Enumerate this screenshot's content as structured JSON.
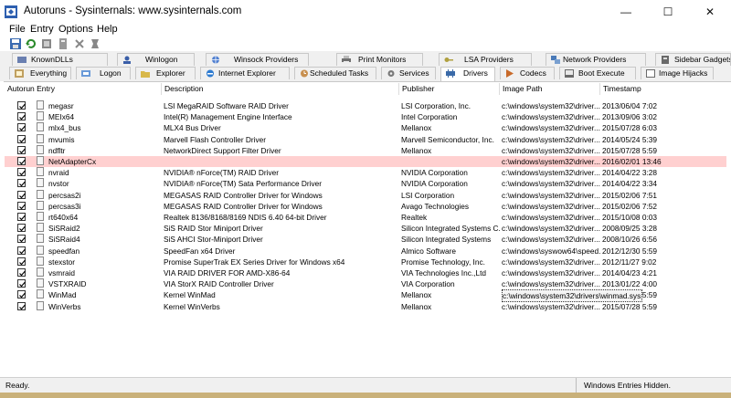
{
  "window": {
    "title": "Autoruns - Sysinternals: www.sysinternals.com",
    "minimize": "—",
    "maximize": "☐",
    "close": "✕"
  },
  "menu": [
    "File",
    "Entry",
    "Options",
    "Help"
  ],
  "toolbar": [
    "save-icon",
    "refresh-icon",
    "filter-icon",
    "jump-icon",
    "delete-icon",
    "find-icon"
  ],
  "tabs_row1": [
    {
      "label": "KnownDLLs",
      "icon": "dll-icon",
      "color": "#6a7fb0"
    },
    {
      "label": "Winlogon",
      "icon": "user-icon",
      "color": "#3a5ea8"
    },
    {
      "label": "Winsock Providers",
      "icon": "globe-icon",
      "color": "#4f7fd0"
    },
    {
      "label": "Print Monitors",
      "icon": "printer-icon",
      "color": "#707070"
    },
    {
      "label": "LSA Providers",
      "icon": "key-icon",
      "color": "#b0a040"
    },
    {
      "label": "Network Providers",
      "icon": "network-icon",
      "color": "#4a7ab8"
    },
    {
      "label": "Sidebar Gadgets",
      "icon": "gadget-icon",
      "color": "#6a6a6a"
    }
  ],
  "tabs_row2": [
    {
      "label": "Everything",
      "icon": "everything-icon",
      "color": "#c0a060"
    },
    {
      "label": "Logon",
      "icon": "logon-icon",
      "color": "#6a9ad8"
    },
    {
      "label": "Explorer",
      "icon": "folder-icon",
      "color": "#d8b84a"
    },
    {
      "label": "Internet Explorer",
      "icon": "ie-icon",
      "color": "#2e7bd0"
    },
    {
      "label": "Scheduled Tasks",
      "icon": "clock-icon",
      "color": "#c89050"
    },
    {
      "label": "Services",
      "icon": "gear-icon",
      "color": "#7a7a7a"
    },
    {
      "label": "Drivers",
      "icon": "driver-icon",
      "color": "#3a6aa8"
    },
    {
      "label": "Codecs",
      "icon": "codec-icon",
      "color": "#c86a2a"
    },
    {
      "label": "Boot Execute",
      "icon": "boot-icon",
      "color": "#6a6a6a"
    },
    {
      "label": "Image Hijacks",
      "icon": "image-icon",
      "color": "#6a6a6a"
    }
  ],
  "active_tab": "Drivers",
  "columns": [
    "Autorun Entry",
    "Description",
    "Publisher",
    "Image Path",
    "Timestamp"
  ],
  "rows": [
    {
      "entry": "megasr",
      "desc": "LSI MegaRAID Software RAID Driver",
      "pub": "LSI Corporation, Inc.",
      "path": "c:\\windows\\system32\\driver...",
      "time": "2013/06/04 7:02"
    },
    {
      "entry": "MEIx64",
      "desc": "Intel(R) Management Engine Interface",
      "pub": "Intel Corporation",
      "path": "c:\\windows\\system32\\driver...",
      "time": "2013/09/06 3:02"
    },
    {
      "entry": "mlx4_bus",
      "desc": "MLX4 Bus Driver",
      "pub": "Mellanox",
      "path": "c:\\windows\\system32\\driver...",
      "time": "2015/07/28 6:03"
    },
    {
      "entry": "mvumis",
      "desc": "Marvell Flash Controller Driver",
      "pub": "Marvell Semiconductor, Inc.",
      "path": "c:\\windows\\system32\\driver...",
      "time": "2014/05/24 5:39"
    },
    {
      "entry": "ndfltr",
      "desc": "NetworkDirect Support Filter Driver",
      "pub": "Mellanox",
      "path": "c:\\windows\\system32\\driver...",
      "time": "2015/07/28 5:59"
    },
    {
      "entry": "NetAdapterCx",
      "desc": "",
      "pub": "",
      "path": "c:\\windows\\system32\\driver...",
      "time": "2016/02/01 13:46",
      "highlight": true
    },
    {
      "entry": "nvraid",
      "desc": "NVIDIA® nForce(TM) RAID Driver",
      "pub": "NVIDIA Corporation",
      "path": "c:\\windows\\system32\\driver...",
      "time": "2014/04/22 3:28"
    },
    {
      "entry": "nvstor",
      "desc": "NVIDIA® nForce(TM) Sata Performance Driver",
      "pub": "NVIDIA Corporation",
      "path": "c:\\windows\\system32\\driver...",
      "time": "2014/04/22 3:34"
    },
    {
      "entry": "percsas2i",
      "desc": "MEGASAS RAID Controller Driver for Windows",
      "pub": "LSI Corporation",
      "path": "c:\\windows\\system32\\driver...",
      "time": "2015/02/06 7:51"
    },
    {
      "entry": "percsas3i",
      "desc": "MEGASAS RAID Controller Driver for Windows",
      "pub": "Avago Technologies",
      "path": "c:\\windows\\system32\\driver...",
      "time": "2015/02/06 7:52"
    },
    {
      "entry": "rt640x64",
      "desc": "Realtek 8136/8168/8169 NDIS 6.40 64-bit Driver",
      "pub": "Realtek",
      "path": "c:\\windows\\system32\\driver...",
      "time": "2015/10/08 0:03"
    },
    {
      "entry": "SiSRaid2",
      "desc": "SiS RAID Stor Miniport Driver",
      "pub": "Silicon Integrated Systems C...",
      "path": "c:\\windows\\system32\\driver...",
      "time": "2008/09/25 3:28"
    },
    {
      "entry": "SiSRaid4",
      "desc": "SiS AHCI Stor-Miniport Driver",
      "pub": "Silicon Integrated Systems",
      "path": "c:\\windows\\system32\\driver...",
      "time": "2008/10/26 6:56"
    },
    {
      "entry": "speedfan",
      "desc": "SpeedFan x64 Driver",
      "pub": "Almico Software",
      "path": "c:\\windows\\syswow64\\speed...",
      "time": "2012/12/30 5:59"
    },
    {
      "entry": "stexstor",
      "desc": "Promise SuperTrak EX Series Driver for Windows x64",
      "pub": "Promise Technology, Inc.",
      "path": "c:\\windows\\system32\\driver...",
      "time": "2012/11/27 9:02"
    },
    {
      "entry": "vsmraid",
      "desc": "VIA RAID DRIVER FOR AMD-X86-64",
      "pub": "VIA Technologies Inc.,Ltd",
      "path": "c:\\windows\\system32\\driver...",
      "time": "2014/04/23 4:21"
    },
    {
      "entry": "VSTXRAID",
      "desc": "VIA StorX RAID Controller Driver",
      "pub": "VIA Corporation",
      "path": "c:\\windows\\system32\\driver...",
      "time": "2013/01/22 4:00"
    },
    {
      "entry": "WinMad",
      "desc": "Kernel WinMad",
      "pub": "Mellanox",
      "path": "c:\\windows\\system32\\drivers\\winmad.sys",
      "time": "2015/07/28 5:59",
      "selected_path": true
    },
    {
      "entry": "WinVerbs",
      "desc": "Kernel WinVerbs",
      "pub": "Mellanox",
      "path": "c:\\windows\\system32\\driver...",
      "time": "2015/07/28 5:59"
    }
  ],
  "status": {
    "left": "Ready.",
    "right": "Windows Entries Hidden."
  },
  "colors": {
    "highlight_row": "#ffd0d0",
    "bottom_strip": "#c9b17a"
  }
}
